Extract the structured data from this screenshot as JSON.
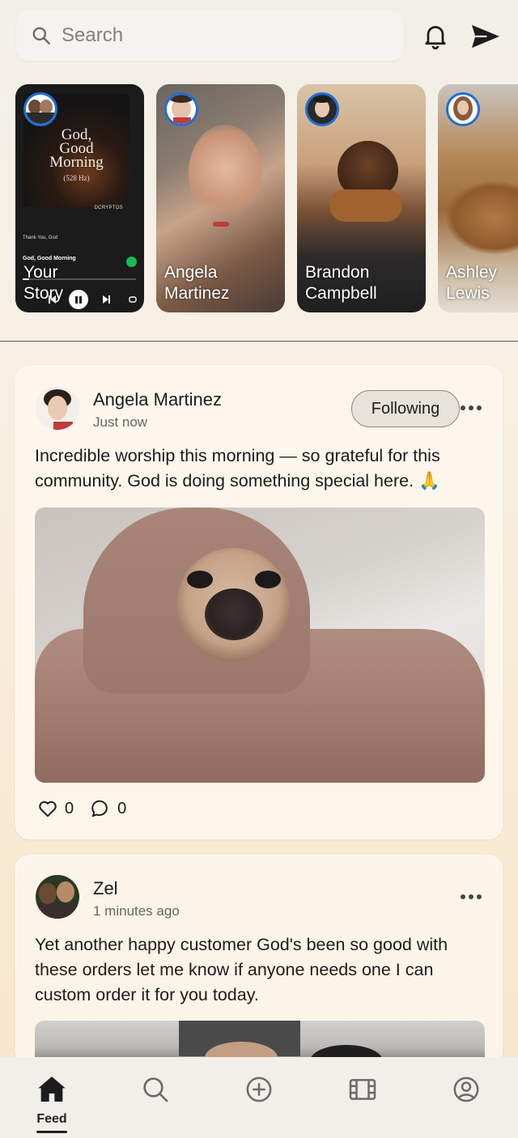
{
  "header": {
    "search_placeholder": "Search",
    "icons": [
      "search-icon",
      "bell-icon",
      "send-icon"
    ]
  },
  "stories": [
    {
      "name_line1": "Your",
      "name_line2": "Story",
      "player": {
        "album_title_1": "God,",
        "album_title_2": "Good",
        "album_title_3": "Morning",
        "album_sub": "(528 Hz)",
        "artist": "DCRYPTOS",
        "small_label": "Thank You, God",
        "track": "God, Good Morning"
      }
    },
    {
      "name_line1": "Angela",
      "name_line2": "Martinez"
    },
    {
      "name_line1": "Brandon",
      "name_line2": "Campbell"
    },
    {
      "name_line1": "Ashley",
      "name_line2": "Lewis"
    }
  ],
  "posts": [
    {
      "author": "Angela Martinez",
      "time": "Just now",
      "follow_label": "Following",
      "text": "Incredible worship this morning — so grateful for this community. God is doing something special here. 🙏",
      "image": "pug-in-blanket-photo",
      "likes": "0",
      "comments": "0"
    },
    {
      "author": "Zel",
      "time": "1 minutes ago",
      "text": "Yet another happy customer God's been so good with these orders let me know if anyone needs one I can custom order it for you today.",
      "image": "kitchen-photo"
    }
  ],
  "bottom_nav": {
    "items": [
      "home-icon",
      "search-icon",
      "add-icon",
      "film-icon",
      "profile-icon"
    ],
    "active_label": "Feed"
  },
  "colors": {
    "story_ring": "#1e6fd9",
    "check_green": "#1db954"
  }
}
